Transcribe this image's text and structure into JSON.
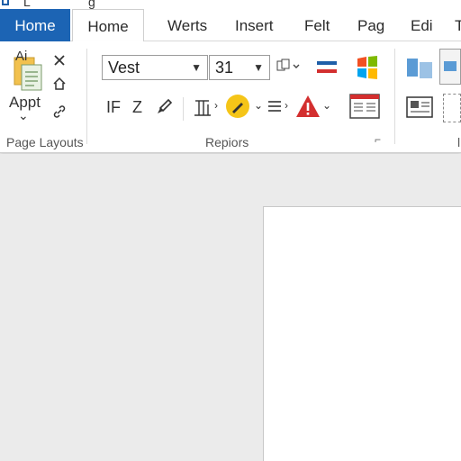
{
  "window": {
    "title_fragment_1": "L",
    "title_fragment_2": "g"
  },
  "tabs": [
    {
      "label": "Home"
    },
    {
      "label": "Home"
    },
    {
      "label": "Werts"
    },
    {
      "label": "Insert"
    },
    {
      "label": "Felt"
    },
    {
      "label": "Pag"
    },
    {
      "label": "Edi"
    },
    {
      "label": "T"
    }
  ],
  "ribbon": {
    "clipboard": {
      "icon_text": "Ai",
      "button_label": "Appt",
      "group_label": "Page Layouts"
    },
    "font": {
      "font_name": "Vest",
      "font_size": "31",
      "if_label": "IF",
      "z_label": "Z",
      "group_label": "Repiors"
    },
    "right_group_label": "l"
  },
  "colors": {
    "file_tab": "#1c64b4",
    "accent_yellow": "#f5c518",
    "warning_red": "#d32f2f",
    "ribbon_bg": "#ffffff",
    "doc_bg": "#ebebeb"
  }
}
